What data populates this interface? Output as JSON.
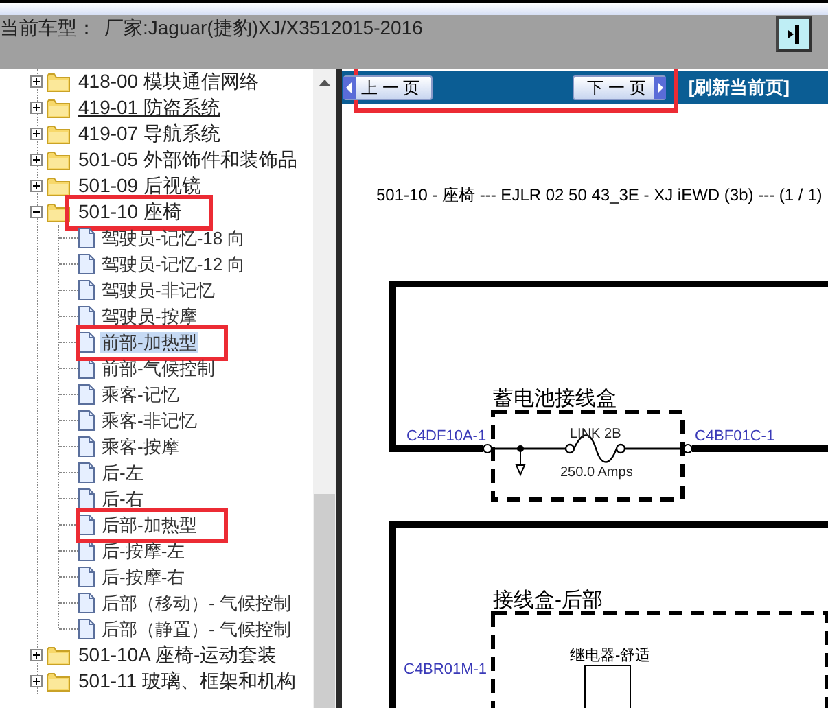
{
  "header": {
    "label": "当前车型：",
    "vehicle": "厂家:Jaguar(捷豹)XJ/X3512015-2016"
  },
  "tree": [
    {
      "label": "418-00 模块通信网络",
      "expanded": false,
      "selected": false,
      "hovered": false,
      "annotated": false
    },
    {
      "label": "419-01 防盗系统",
      "expanded": false,
      "selected": false,
      "hovered": true,
      "annotated": false
    },
    {
      "label": "419-07 导航系统",
      "expanded": false,
      "selected": false,
      "hovered": false,
      "annotated": false
    },
    {
      "label": "501-05 外部饰件和装饰品",
      "expanded": false,
      "selected": false,
      "hovered": false,
      "annotated": false
    },
    {
      "label": "501-09 后视镜",
      "expanded": false,
      "selected": false,
      "hovered": false,
      "annotated": false
    },
    {
      "label": "501-10 座椅",
      "expanded": true,
      "selected": false,
      "hovered": false,
      "annotated": true,
      "children": [
        {
          "label": "驾驶员-记忆-18 向",
          "selected": false,
          "annotated": false
        },
        {
          "label": "驾驶员-记忆-12 向",
          "selected": false,
          "annotated": false
        },
        {
          "label": "驾驶员-非记忆",
          "selected": false,
          "annotated": false
        },
        {
          "label": "驾驶员-按摩",
          "selected": false,
          "annotated": false
        },
        {
          "label": "前部-加热型",
          "selected": true,
          "annotated": true
        },
        {
          "label": "前部-气候控制",
          "selected": false,
          "annotated": false
        },
        {
          "label": "乘客-记忆",
          "selected": false,
          "annotated": false
        },
        {
          "label": "乘客-非记忆",
          "selected": false,
          "annotated": false
        },
        {
          "label": "乘客-按摩",
          "selected": false,
          "annotated": false
        },
        {
          "label": "后-左",
          "selected": false,
          "annotated": false
        },
        {
          "label": "后-右",
          "selected": false,
          "annotated": false
        },
        {
          "label": "后部-加热型",
          "selected": false,
          "annotated": true
        },
        {
          "label": "后-按摩-左",
          "selected": false,
          "annotated": false
        },
        {
          "label": "后-按摩-右",
          "selected": false,
          "annotated": false
        },
        {
          "label": "后部（移动）- 气候控制",
          "selected": false,
          "annotated": false
        },
        {
          "label": "后部（静置）- 气候控制",
          "selected": false,
          "annotated": false
        }
      ]
    },
    {
      "label": "501-10A 座椅-运动套装",
      "expanded": false,
      "selected": false,
      "hovered": false,
      "annotated": false
    },
    {
      "label": "501-11 玻璃、框架和机构",
      "expanded": false,
      "selected": false,
      "hovered": false,
      "annotated": false
    }
  ],
  "toolbar": {
    "prev": "上 一 页",
    "next": "下 一 页",
    "refresh": "[刷新当前页]",
    "annotated": true
  },
  "document": {
    "title": "501-10 - 座椅 --- EJLR 02 50 43_3E - XJ iEWD (3b) --- (1 / 1)",
    "battery_box": {
      "title": "蓄电池接线盒",
      "left_pin": "C4DF10A-1",
      "right_pin": "C4BF01C-1",
      "fuse_label": "LINK 2B",
      "fuse_rating": "250.0 Amps"
    },
    "rear_box": {
      "title": "接线盒-后部",
      "relay_label": "继电器-舒适",
      "left_pin": "C4BR01M-1"
    }
  }
}
